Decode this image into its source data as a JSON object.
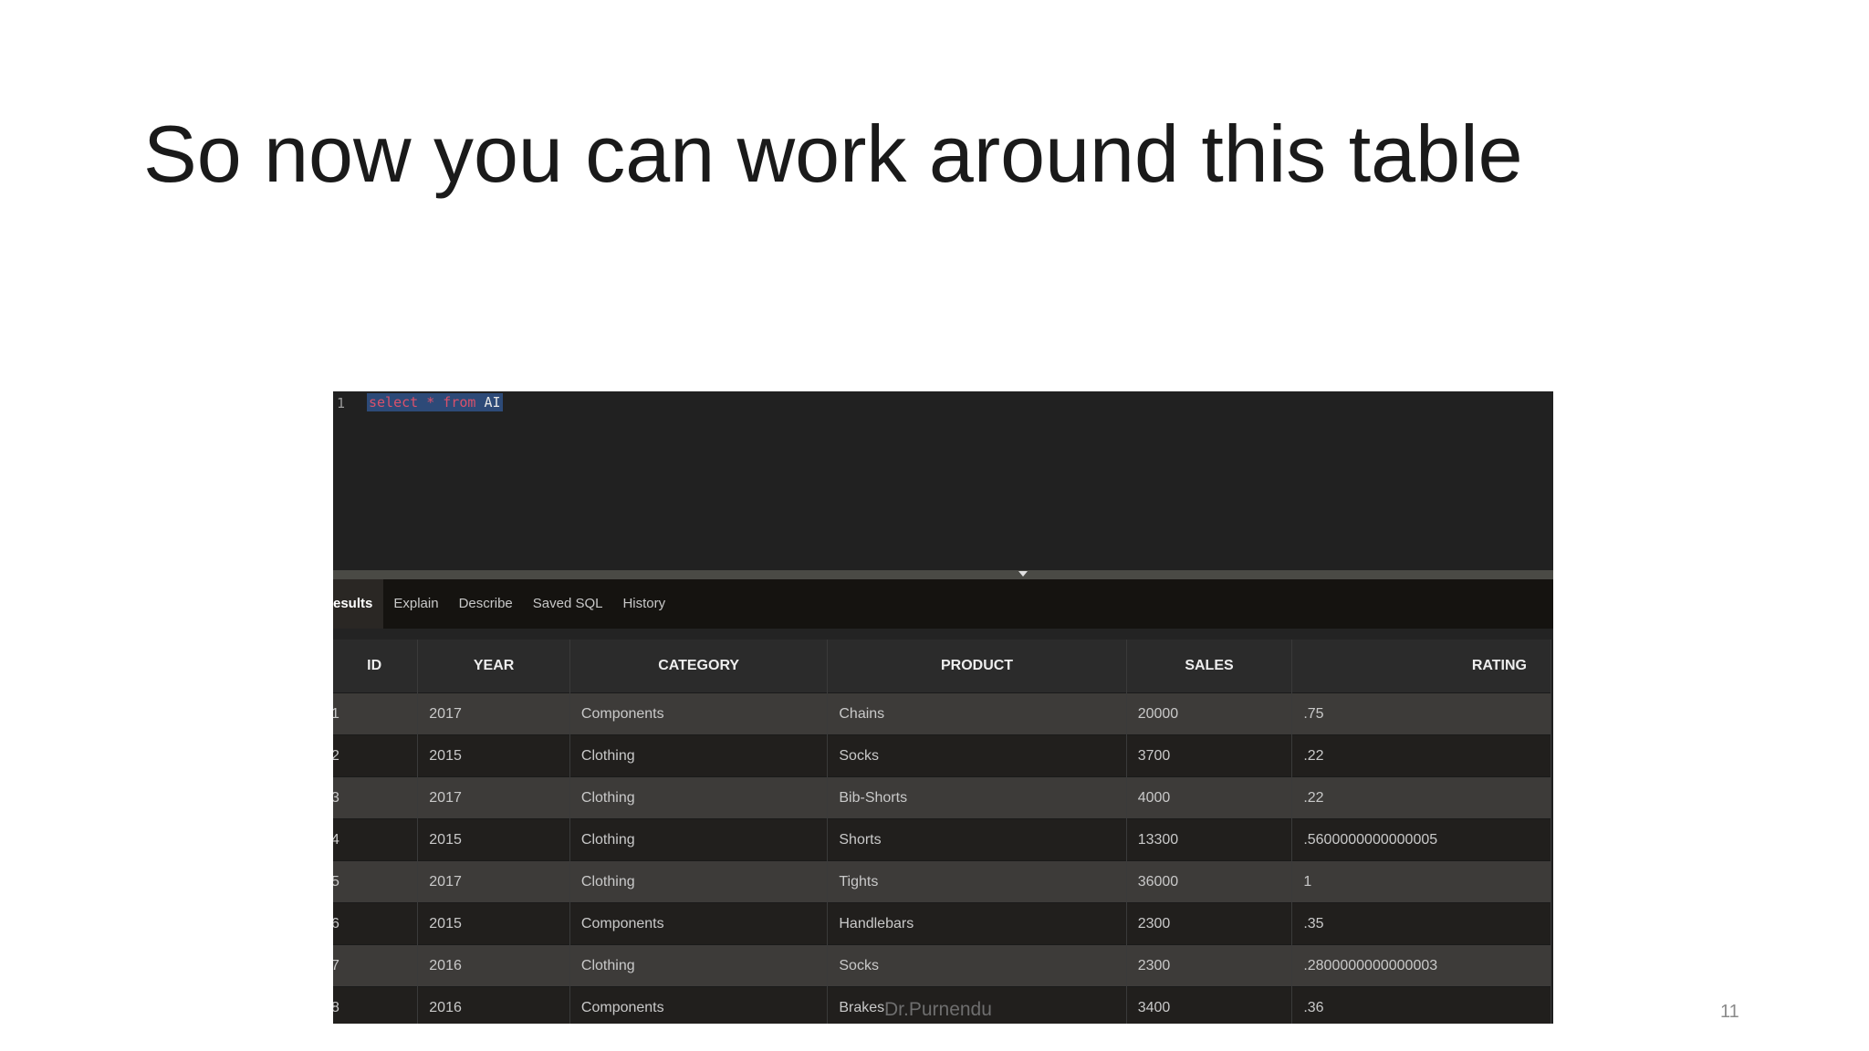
{
  "slide": {
    "title": "So now you can work around this table",
    "author": "Dr.Purnendu",
    "page_number": "11"
  },
  "editor": {
    "line_number": "1",
    "keyword_select": "select",
    "asterisk": "*",
    "keyword_from": "from",
    "table_name": "AI"
  },
  "tabs": [
    "esults",
    "Explain",
    "Describe",
    "Saved SQL",
    "History"
  ],
  "table": {
    "columns": [
      "ID",
      "YEAR",
      "CATEGORY",
      "PRODUCT",
      "SALES",
      "RATING"
    ],
    "rows": [
      [
        "1",
        "2017",
        "Components",
        "Chains",
        "20000",
        ".75"
      ],
      [
        "2",
        "2015",
        "Clothing",
        "Socks",
        "3700",
        ".22"
      ],
      [
        "3",
        "2017",
        "Clothing",
        "Bib-Shorts",
        "4000",
        ".22"
      ],
      [
        "4",
        "2015",
        "Clothing",
        "Shorts",
        "13300",
        ".5600000000000005"
      ],
      [
        "5",
        "2017",
        "Clothing",
        "Tights",
        "36000",
        "1"
      ],
      [
        "6",
        "2015",
        "Components",
        "Handlebars",
        "2300",
        ".35"
      ],
      [
        "7",
        "2016",
        "Clothing",
        "Socks",
        "2300",
        ".2800000000000003"
      ],
      [
        "8",
        "2016",
        "Components",
        "Brakes",
        "3400",
        ".36"
      ]
    ]
  }
}
